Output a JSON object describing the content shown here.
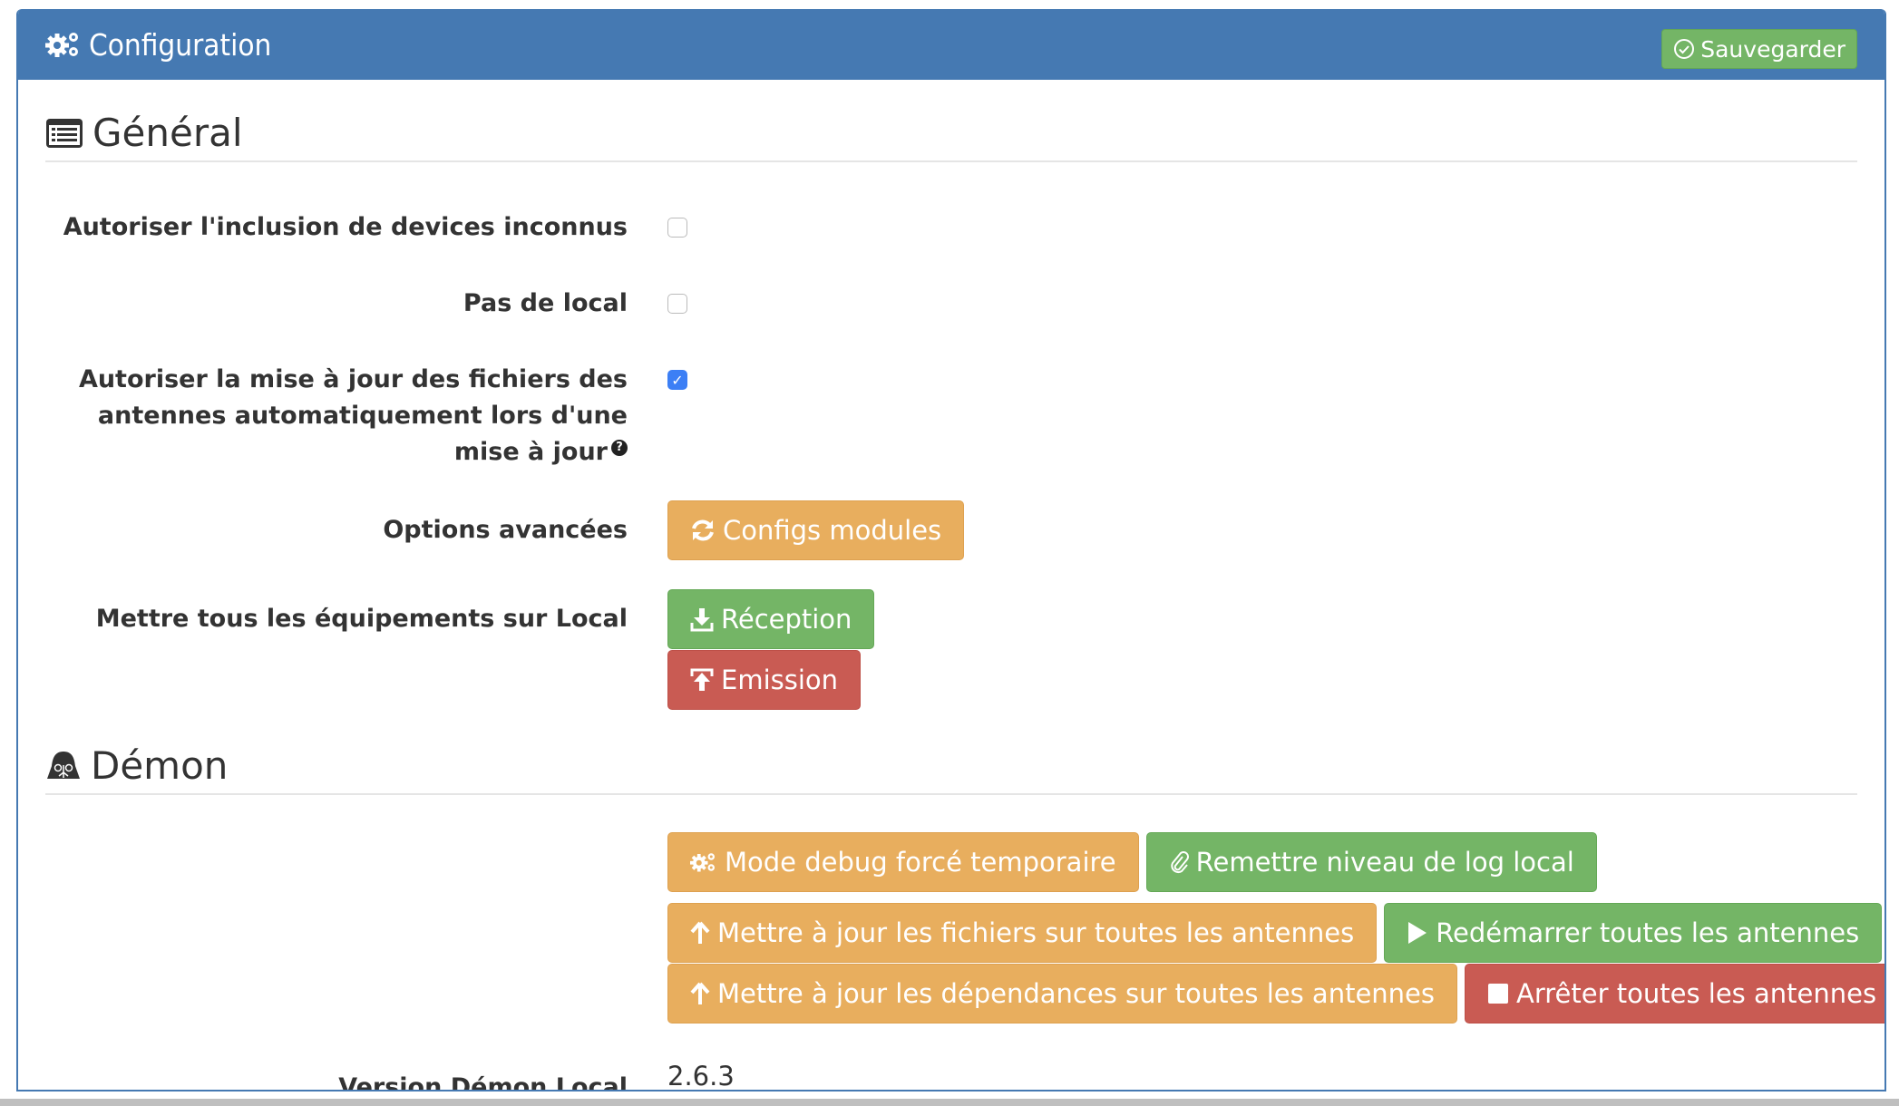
{
  "header": {
    "title": "Configuration",
    "title_icon": "cogs-icon",
    "save_label": "Sauvegarder",
    "save_icon": "check-circle-icon"
  },
  "general": {
    "heading": "Général",
    "heading_icon": "list-alt-icon",
    "settings": [
      {
        "label": "Autoriser l'inclusion de devices inconnus",
        "checked": false
      },
      {
        "label": "Pas de local",
        "checked": false
      },
      {
        "label": "Autoriser la mise à jour des fichiers des antennes automatiquement lors d'une mise à jour",
        "checked": true,
        "help_icon": "question-circle-icon"
      }
    ],
    "advanced": {
      "label": "Options avancées",
      "button": "Configs modules",
      "button_icon": "refresh-icon"
    },
    "local": {
      "label": "Mettre tous les équipements sur Local",
      "reception": "Réception",
      "reception_icon": "download-icon",
      "emission": "Emission",
      "emission_icon": "upload-icon"
    }
  },
  "daemon": {
    "heading": "Démon",
    "heading_icon": "darth-vader-icon",
    "buttons": {
      "debug": "Mode debug forcé temporaire",
      "reset_log": "Remettre niveau de log local",
      "update_files": "Mettre à jour les fichiers sur toutes les antennes",
      "restart": "Redémarrer toutes les antennes",
      "update_deps": "Mettre à jour les dépendances sur toutes les antennes",
      "stop": "Arrêter toutes les antennes"
    },
    "version_label": "Version Démon Local",
    "version_value": "2.6.3"
  }
}
